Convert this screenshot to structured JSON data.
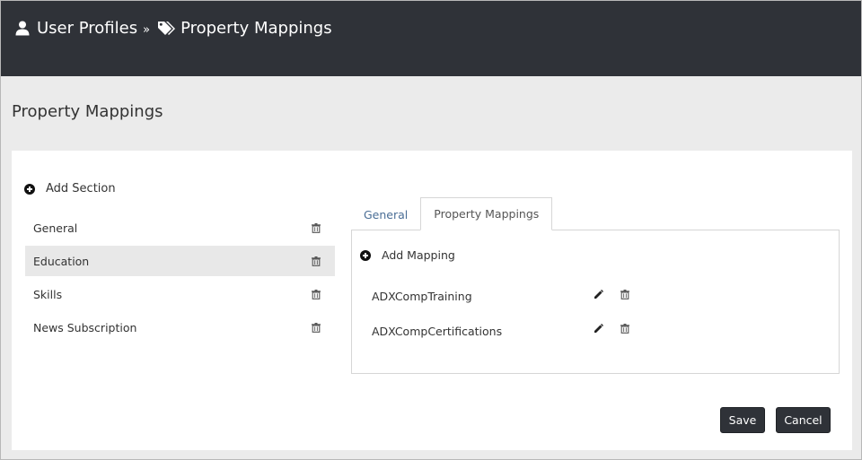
{
  "header": {
    "crumb_1": "User Profiles",
    "separator": "»",
    "crumb_2": "Property Mappings"
  },
  "page": {
    "title": "Property Mappings"
  },
  "sections": {
    "add_label": "Add Section",
    "items": [
      {
        "label": "General",
        "selected": false
      },
      {
        "label": "Education",
        "selected": true
      },
      {
        "label": "Skills",
        "selected": false
      },
      {
        "label": "News Subscription",
        "selected": false
      }
    ]
  },
  "tabs": [
    {
      "label": "General",
      "active": false
    },
    {
      "label": "Property Mappings",
      "active": true
    }
  ],
  "mappings": {
    "add_label": "Add Mapping",
    "items": [
      {
        "label": "ADXCompTraining"
      },
      {
        "label": "ADXCompCertifications"
      }
    ]
  },
  "buttons": {
    "save": "Save",
    "cancel": "Cancel"
  },
  "colors": {
    "header_bg": "#2f3238",
    "tab_link": "#4a6e96",
    "button_bg": "#2f3238"
  }
}
